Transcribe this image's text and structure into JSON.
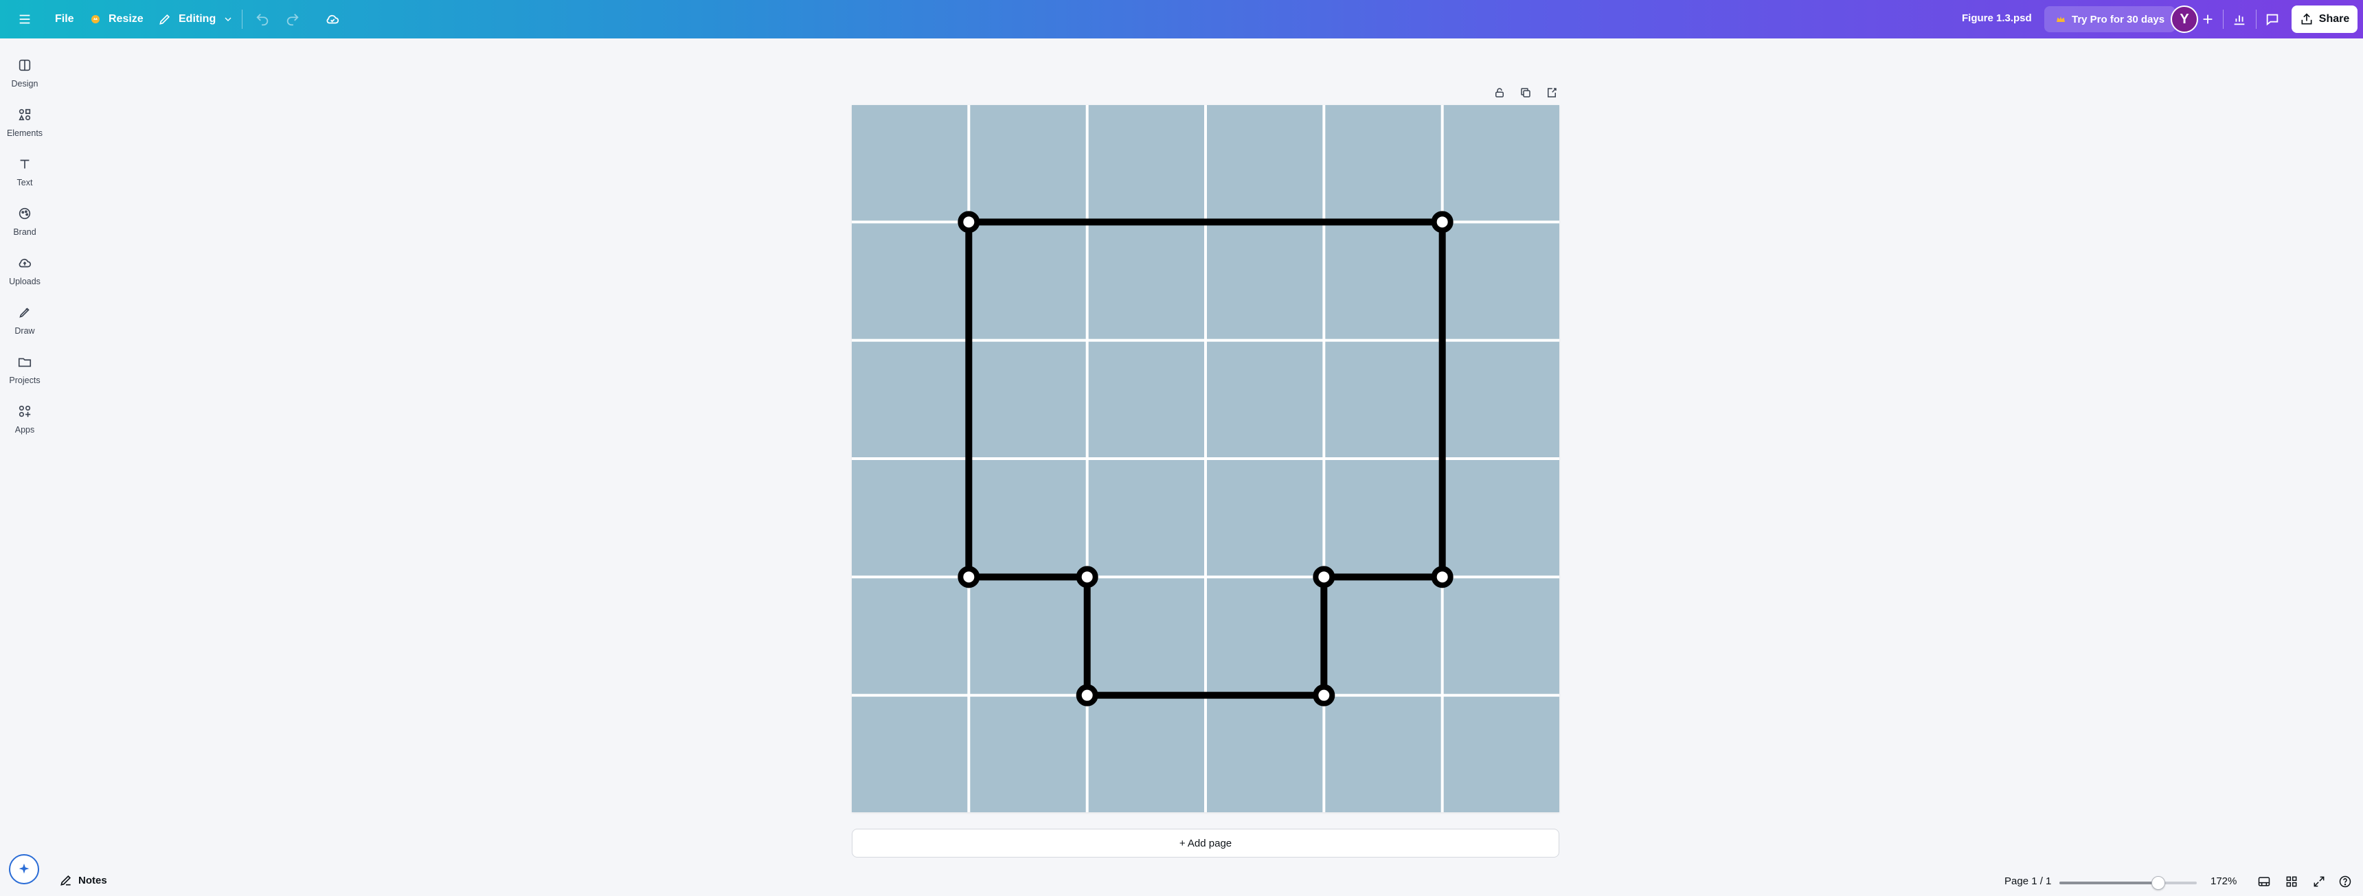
{
  "topbar": {
    "file_label": "File",
    "resize_label": "Resize",
    "editing_label": "Editing",
    "doc_title": "Figure 1.3.psd",
    "pro_label": "Try Pro for 30 days",
    "avatar_initial": "Y",
    "share_label": "Share"
  },
  "sidebar": {
    "items": [
      {
        "label": "Design",
        "icon": "design-icon"
      },
      {
        "label": "Elements",
        "icon": "elements-icon"
      },
      {
        "label": "Text",
        "icon": "text-icon"
      },
      {
        "label": "Brand",
        "icon": "brand-icon"
      },
      {
        "label": "Uploads",
        "icon": "uploads-icon"
      },
      {
        "label": "Draw",
        "icon": "draw-icon"
      },
      {
        "label": "Projects",
        "icon": "projects-icon"
      },
      {
        "label": "Apps",
        "icon": "apps-icon"
      }
    ]
  },
  "canvas": {
    "grid": {
      "rows": 6,
      "cols": 6,
      "cell_color": "#a7c0ce",
      "line_color": "#ffffff"
    },
    "figure": {
      "stroke": "#000000",
      "vertices": [
        [
          1,
          1
        ],
        [
          5,
          1
        ],
        [
          5,
          4
        ],
        [
          4,
          4
        ],
        [
          4,
          5
        ],
        [
          2,
          5
        ],
        [
          2,
          4
        ],
        [
          1,
          4
        ]
      ]
    }
  },
  "add_page_label": "+ Add page",
  "bottom": {
    "notes_label": "Notes",
    "page_label": "Page 1 / 1",
    "zoom_label": "172%",
    "zoom_fraction": 0.72
  },
  "colors": {
    "accent": "#7a3fe3",
    "avatar": "#7b1c8f"
  }
}
